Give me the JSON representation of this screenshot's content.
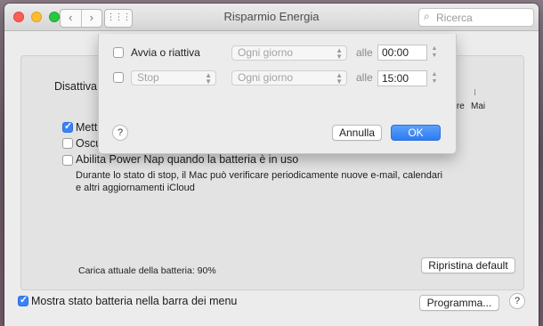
{
  "window": {
    "title": "Risparmio Energia",
    "search_placeholder": "Ricerca"
  },
  "toolbar": {
    "back_glyph": "‹",
    "forward_glyph": "›",
    "grid_glyph": "⋮⋮⋮"
  },
  "main": {
    "slider_label": "Disattiva",
    "tick_labels": [
      "3 ore",
      "Mai"
    ],
    "options": [
      {
        "label": "Mett",
        "checked": true
      },
      {
        "label": "Oscu",
        "checked": false
      },
      {
        "label": "Abilita Power Nap quando la batteria è in uso",
        "checked": false
      }
    ],
    "power_nap_description": "Durante lo stato di stop, il Mac può verificare periodicamente nuove e-mail, calendari e altri aggiornamenti iCloud",
    "battery_charge": "Carica attuale della batteria: 90%",
    "restore_button": "Ripristina default"
  },
  "footer": {
    "show_battery_label": "Mostra stato batteria nella barra dei menu",
    "show_battery_checked": true,
    "schedule_button": "Programma...",
    "help": "?"
  },
  "sheet": {
    "rows": [
      {
        "label": "Avvia o riattiva",
        "checked": false,
        "day": "Ogni giorno",
        "at": "alle",
        "time": "00:00"
      },
      {
        "label": "",
        "action": "Stop",
        "checked": false,
        "day": "Ogni giorno",
        "at": "alle",
        "time": "15:00"
      }
    ],
    "help": "?",
    "cancel_button": "Annulla",
    "ok_button": "OK",
    "accent_color": "#2f7cf4"
  }
}
